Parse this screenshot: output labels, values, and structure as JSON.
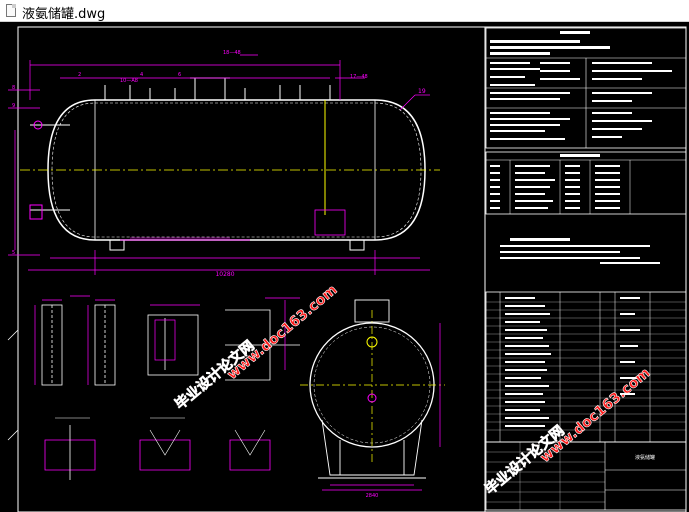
{
  "window": {
    "file_name": "液氨储罐.dwg"
  },
  "drawing": {
    "dimensions": {
      "overall_length": "10280",
      "leader_label": "19",
      "small_refs": [
        "8",
        "9",
        "10",
        "11",
        "12",
        "13",
        "14",
        "15",
        "16",
        "17"
      ]
    },
    "title_block": {
      "name_cell": "液氨储罐"
    },
    "watermarks": {
      "site_cn": "毕业设计论文网",
      "site_url": "www.doc163.com"
    }
  },
  "colors": {
    "magenta": "#ff00ff",
    "white": "#ffffff",
    "yellow": "#ffff00",
    "cyan": "#00ffff",
    "red_watermark": "#ff1a1a"
  }
}
